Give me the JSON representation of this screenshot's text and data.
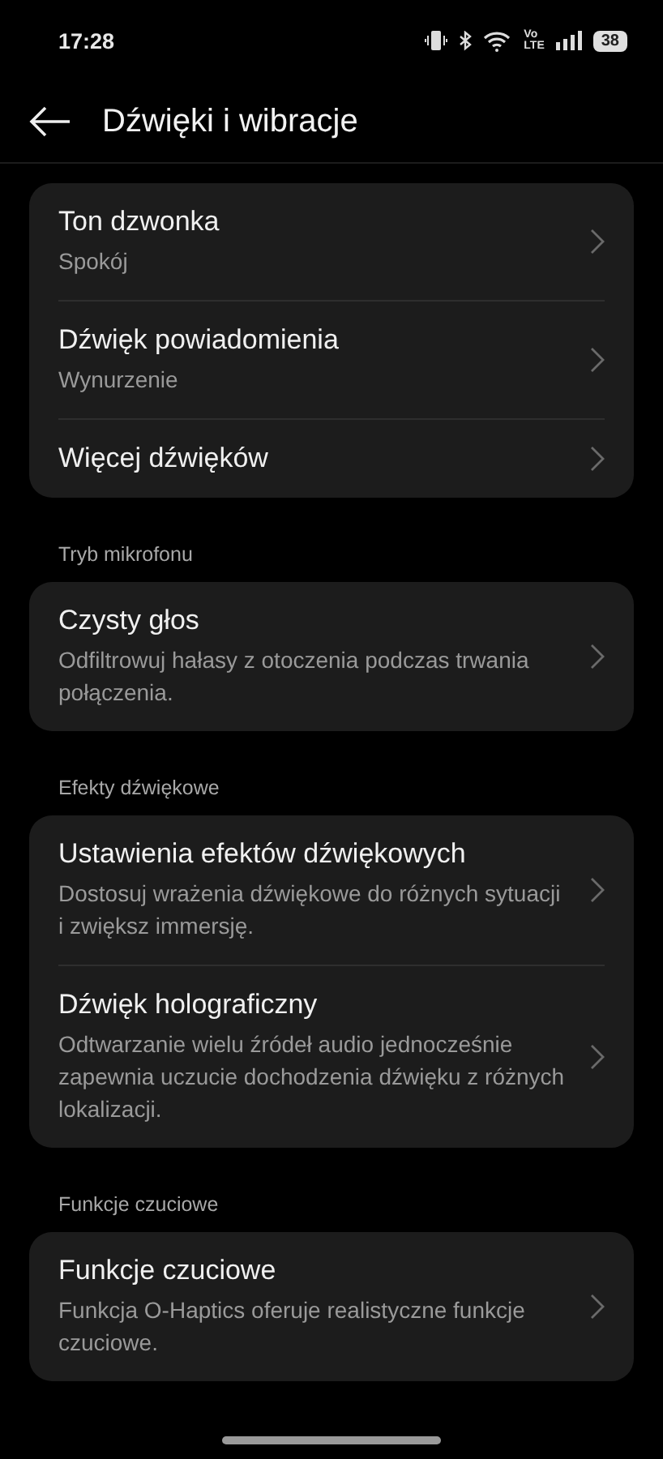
{
  "status_bar": {
    "time": "17:28",
    "network_top": "Vo",
    "network_bottom": "LTE",
    "battery": "38"
  },
  "header": {
    "title": "Dźwięki i wibracje"
  },
  "sections": [
    {
      "items": [
        {
          "title": "Ton dzwonka",
          "subtitle": "Spokój"
        },
        {
          "title": "Dźwięk powiadomienia",
          "subtitle": "Wynurzenie"
        },
        {
          "title": "Więcej dźwięków"
        }
      ]
    },
    {
      "label": "Tryb mikrofonu",
      "items": [
        {
          "title": "Czysty głos",
          "subtitle": "Odfiltrowuj hałasy z otoczenia podczas trwania połączenia."
        }
      ]
    },
    {
      "label": "Efekty dźwiękowe",
      "items": [
        {
          "title": "Ustawienia efektów dźwiękowych",
          "subtitle": "Dostosuj wrażenia dźwiękowe do różnych sytuacji i zwiększ immersję."
        },
        {
          "title": "Dźwięk holograficzny",
          "subtitle": "Odtwarzanie wielu źródeł audio jednocześnie zapewnia uczucie dochodzenia dźwięku z różnych lokalizacji."
        }
      ]
    },
    {
      "label": "Funkcje czuciowe",
      "items": [
        {
          "title": "Funkcje czuciowe",
          "subtitle": "Funkcja O-Haptics oferuje realistyczne funkcje czuciowe."
        }
      ]
    }
  ]
}
